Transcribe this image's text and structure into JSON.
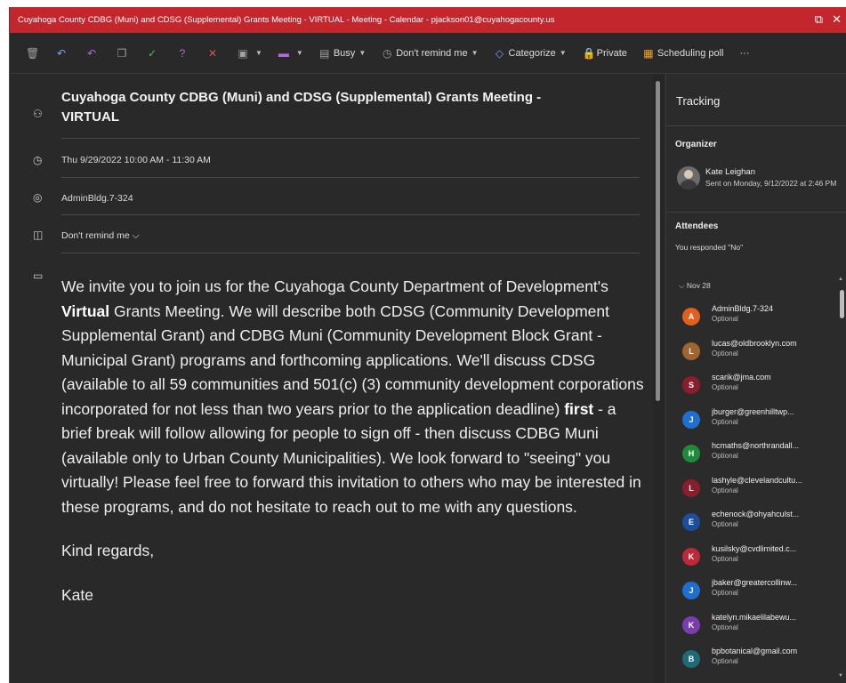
{
  "window": {
    "title": "Cuyahoga County CDBG (Muni) and CDSG (Supplemental) Grants Meeting - VIRTUAL - Meeting - Calendar - pjackson01@cuyahogacounty.us"
  },
  "toolbar": {
    "busy_label": "Busy",
    "remind_label": "Don't remind me",
    "categorize_label": "Categorize",
    "private_label": "Private",
    "poll_label": "Scheduling poll",
    "more_label": "···"
  },
  "meeting": {
    "subject": "Cuyahoga County CDBG (Muni) and CDSG (Supplemental) Grants Meeting - VIRTUAL",
    "datetime": "Thu 9/29/2022 10:00 AM - 11:30 AM",
    "location": "AdminBldg.7-324",
    "reminder": "Don't remind me"
  },
  "body": {
    "p1_a": "We invite you to join us for the Cuyahoga County Department of Development's ",
    "p1_bold1": "Virtual",
    "p1_b": " Grants Meeting.  We will describe both CDSG (Community Development Supplemental Grant) and CDBG Muni (Community Development Block Grant - Municipal Grant) programs and forthcoming applications.  We'll discuss CDSG (available to all 59 communities and 501(c) (3) community development corporations incorporated for not less than two years prior to the application deadline) ",
    "p1_bold2": "first",
    "p1_c": " - a brief break will follow allowing for people to sign off - then discuss CDBG Muni (available only to Urban County Municipalities).  We look forward to \"seeing\" you virtually!  Please feel free to forward this invitation to others who may be interested in these programs, and do not hesitate to reach out to me with any questions.",
    "p2": "Kind regards,",
    "p3": "Kate"
  },
  "tracking": {
    "title": "Tracking",
    "organizer_label": "Organizer",
    "organizer_name": "Kate Leighan",
    "organizer_sent": "Sent on Monday, 9/12/2022 at 2:46 PM",
    "attendees_label": "Attendees",
    "response": "You responded \"No\"",
    "group_label": "Nov 28",
    "attendees": [
      {
        "initial": "A",
        "email": "AdminBldg.7-324",
        "status": "Optional",
        "color": "#e0601f"
      },
      {
        "initial": "L",
        "email": "lucas@oldbrooklyn.com",
        "status": "Optional",
        "color": "#a0642e"
      },
      {
        "initial": "S",
        "email": "scarik@jma.com",
        "status": "Optional",
        "color": "#8b1e2d"
      },
      {
        "initial": "J",
        "email": "jburger@greenhilltwp...",
        "status": "Optional",
        "color": "#1f6fd1"
      },
      {
        "initial": "H",
        "email": "hcmaths@northrandall...",
        "status": "Optional",
        "color": "#1e8a3a"
      },
      {
        "initial": "L",
        "email": "lashyle@clevelandcultu...",
        "status": "Optional",
        "color": "#8a1f2b"
      },
      {
        "initial": "E",
        "email": "echenock@ohyahculst...",
        "status": "Optional",
        "color": "#1b4f9c"
      },
      {
        "initial": "K",
        "email": "kusilsky@cvdlimited.c...",
        "status": "Optional",
        "color": "#c0283a"
      },
      {
        "initial": "J",
        "email": "jbaker@greatercollinw...",
        "status": "Optional",
        "color": "#1f6fd1"
      },
      {
        "initial": "K",
        "email": "katelyn.mikaelilabewu...",
        "status": "Optional",
        "color": "#7a3db0"
      },
      {
        "initial": "B",
        "email": "bpbotanical@gmail.com",
        "status": "Optional",
        "color": "#1d6a7a"
      }
    ]
  }
}
